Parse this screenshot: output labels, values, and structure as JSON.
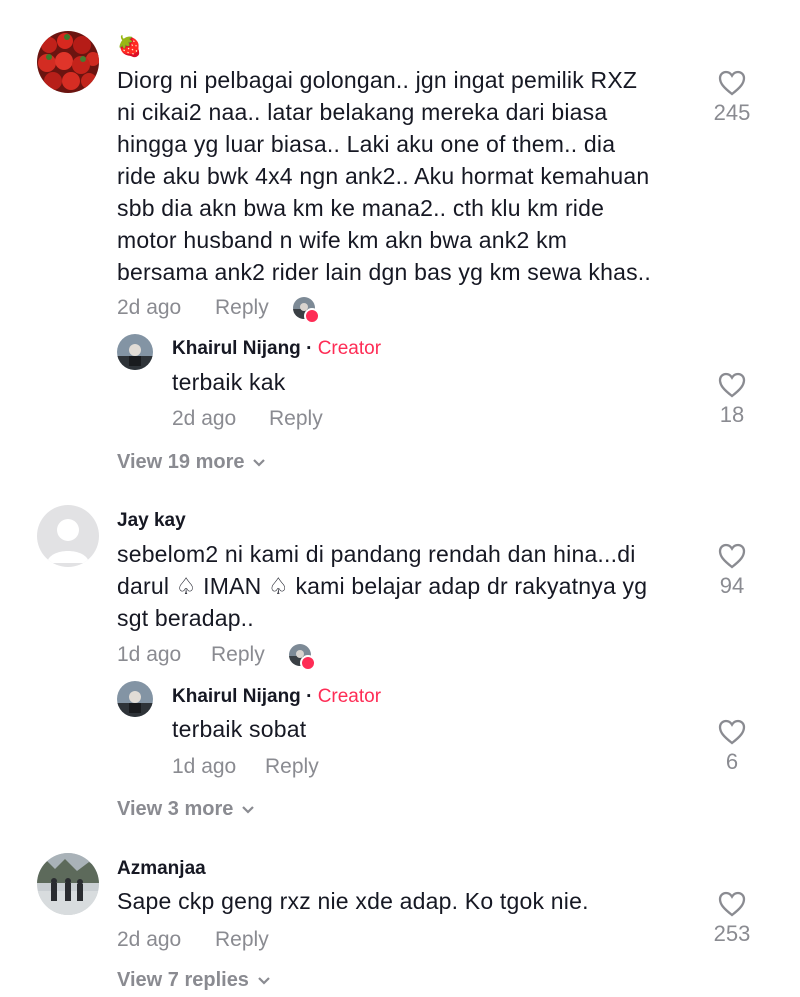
{
  "comments": [
    {
      "username": "🍓",
      "text": "Diorg ni pelbagai golongan.. jgn ingat pemilik RXZ\nni cikai2 naa.. latar belakang mereka dari biasa\nhingga yg luar biasa.. Laki aku one of them.. dia\nride aku bwk 4x4 ngn ank2.. Aku hormat kemahuan\nsbb dia akn bwa km ke mana2.. cth klu km ride\nmotor husband n wife km akn bwa ank2 km\nbersama ank2 rider lain dgn bas yg km sewa khas..",
      "time": "2d ago",
      "reply_label": "Reply",
      "likes": "245",
      "reply": {
        "username": "Khairul Nijang",
        "separator": "·",
        "badge": "Creator",
        "text": "terbaik kak",
        "time": "2d ago",
        "reply_label": "Reply",
        "likes": "18"
      },
      "view_more": "View 19 more"
    },
    {
      "username": "Jay kay",
      "text": "sebelom2 ni kami di pandang rendah dan hina...di\ndarul ♤ IMAN ♤ kami belajar adap dr rakyatnya yg\nsgt beradap..",
      "time": "1d ago",
      "reply_label": "Reply",
      "likes": "94",
      "reply": {
        "username": "Khairul Nijang",
        "separator": "·",
        "badge": "Creator",
        "text": "terbaik sobat",
        "time": "1d ago",
        "reply_label": "Reply",
        "likes": "6"
      },
      "view_more": "View 3 more"
    },
    {
      "username": "Azmanjaa",
      "text": "Sape ckp geng rxz nie xde adap. Ko tgok nie.",
      "time": "2d ago",
      "reply_label": "Reply",
      "likes": "253",
      "view_more": "View 7 replies"
    }
  ]
}
